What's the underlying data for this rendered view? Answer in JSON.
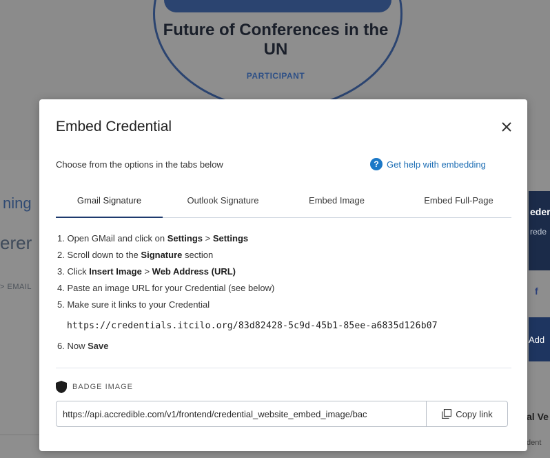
{
  "background": {
    "badge": {
      "title": "Future of Conferences in the UN",
      "role": "PARTICIPANT"
    },
    "left_texts": {
      "training": "ning",
      "conference": "erer",
      "email": "> EMAIL"
    },
    "right_texts": {
      "panel_title": "eder",
      "panel_sub": "rede",
      "facebook": "f",
      "add": "Add",
      "verification": "al Ve",
      "credential": "dent"
    }
  },
  "modal": {
    "title": "Embed Credential",
    "subtitle": "Choose from the options in the tabs below",
    "help_link": "Get help with embedding",
    "tabs": [
      {
        "label": "Gmail Signature",
        "active": true
      },
      {
        "label": "Outlook Signature",
        "active": false
      },
      {
        "label": "Embed Image",
        "active": false
      },
      {
        "label": "Embed Full-Page",
        "active": false
      }
    ],
    "steps": {
      "s1": {
        "prefix": "1. Open GMail and click on ",
        "b1": "Settings",
        "sep": " > ",
        "b2": "Settings"
      },
      "s2": {
        "prefix": "2. Scroll down to the ",
        "b1": "Signature",
        "suffix": " section"
      },
      "s3": {
        "prefix": "3. Click ",
        "b1": "Insert Image",
        "sep": " > ",
        "b2": "Web Address (URL)"
      },
      "s4": {
        "text": "4. Paste an image URL for your Credential (see below)"
      },
      "s5": {
        "text": "5. Make sure it links to your Credential",
        "url": "https://credentials.itcilo.org/83d82428-5c9d-45b1-85ee-a6835d126b07"
      },
      "s6": {
        "prefix": "6. Now ",
        "b1": "Save"
      }
    },
    "badge_image_label": "BADGE IMAGE",
    "image_url": "https://api.accredible.com/v1/frontend/credential_website_embed_image/bac",
    "copy_label": "Copy link"
  },
  "colors": {
    "accent": "#1e3a6e",
    "link": "#1f6fb5",
    "overlay": "#8c8c8c"
  }
}
